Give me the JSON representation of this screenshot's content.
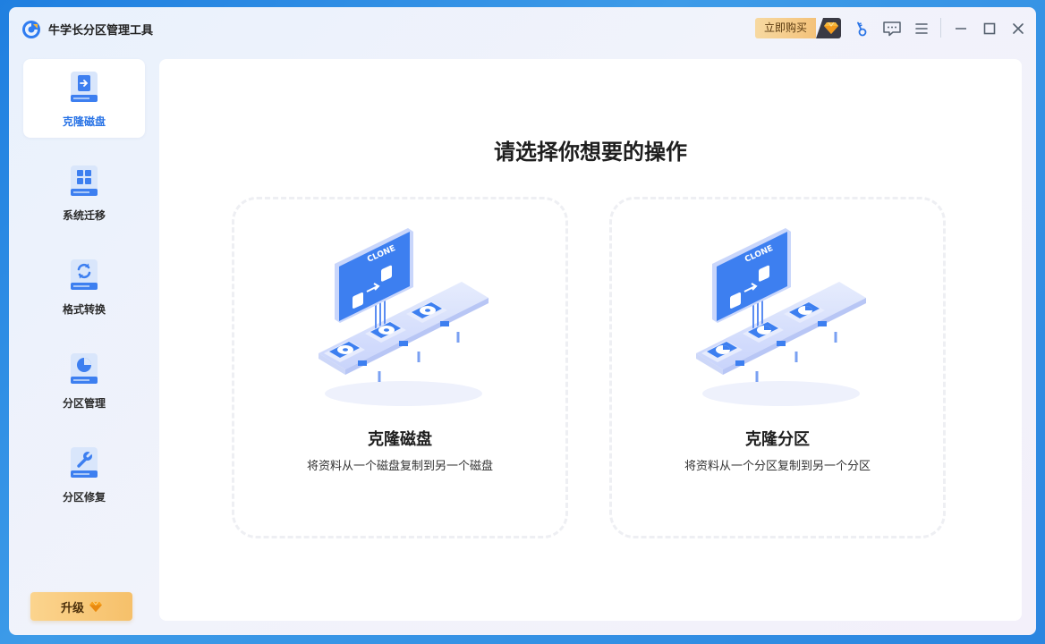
{
  "app": {
    "title": "牛学长分区管理工具"
  },
  "titlebar": {
    "buy_label": "立即购买"
  },
  "sidebar": {
    "items": [
      {
        "label": "克隆磁盘",
        "icon": "clone-disk-icon",
        "active": true
      },
      {
        "label": "系统迁移",
        "icon": "system-migrate-icon",
        "active": false
      },
      {
        "label": "格式转换",
        "icon": "format-convert-icon",
        "active": false
      },
      {
        "label": "分区管理",
        "icon": "partition-manage-icon",
        "active": false
      },
      {
        "label": "分区修复",
        "icon": "partition-repair-icon",
        "active": false
      }
    ],
    "upgrade_label": "升级"
  },
  "main": {
    "title": "请选择你想要的操作",
    "cards": [
      {
        "title": "克隆磁盘",
        "desc": "将资料从一个磁盘复制到另一个磁盘",
        "illustration_text": "CLONE"
      },
      {
        "title": "克隆分区",
        "desc": "将资料从一个分区复制到另一个分区",
        "illustration_text": "CLONE"
      }
    ]
  },
  "colors": {
    "accent": "#2a74e6",
    "gold": "#f6c06a",
    "icon_blue": "#3d7ff0"
  }
}
